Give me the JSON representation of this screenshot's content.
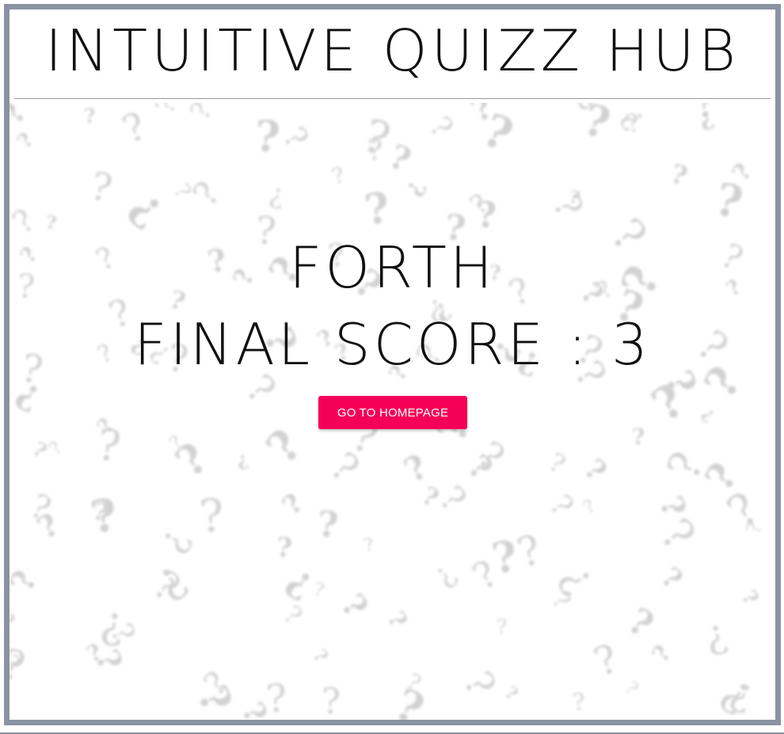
{
  "app": {
    "title": "INTUITIVE QUIZZ HUB"
  },
  "result": {
    "place_text": "FORTH",
    "score_text": "FINAL SCORE : 3"
  },
  "actions": {
    "home_button_label": "GO TO HOMEPAGE"
  },
  "background": {
    "pattern_icon": "question-mark-pattern",
    "pattern_glyphs": [
      "?",
      "¿"
    ]
  },
  "colors": {
    "frame_border": "#8a93a2",
    "button_bg": "#f50057",
    "button_text": "#ffffff",
    "title_text": "#111111",
    "pattern": "#d2d2d2"
  }
}
